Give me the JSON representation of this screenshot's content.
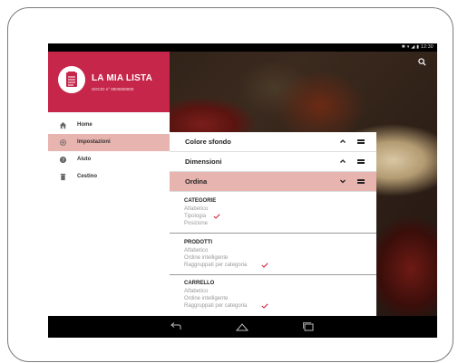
{
  "status_bar": {
    "time": "12:30"
  },
  "drawer": {
    "title": "LA MIA LISTA",
    "subtitle": "SOCIO n° 0000000000",
    "items": [
      {
        "label": "Home",
        "icon": "home-icon",
        "active": false
      },
      {
        "label": "Impostazioni",
        "icon": "gear-icon",
        "active": true
      },
      {
        "label": "Aiuto",
        "icon": "help-icon",
        "active": false
      },
      {
        "label": "Cestino",
        "icon": "trash-icon",
        "active": false
      }
    ]
  },
  "panel": {
    "accordions": [
      {
        "label": "Colore sfondo",
        "state": "collapsed"
      },
      {
        "label": "Dimensioni",
        "state": "collapsed"
      },
      {
        "label": "Ordina",
        "state": "expanded"
      }
    ],
    "sections": [
      {
        "title": "CATEGORIE",
        "options": [
          "Alfabetico",
          "Tipologia",
          "Posizione"
        ],
        "selected": 1
      },
      {
        "title": "PRODOTTI",
        "options": [
          "Alfabetico",
          "Ordine intelligente",
          "Raggruppati per categoria"
        ],
        "selected": 2
      },
      {
        "title": "CARRELLO",
        "options": [
          "Alfabetico",
          "Ordine intelligente",
          "Raggruppati per categoria"
        ],
        "selected": 2
      }
    ]
  },
  "colors": {
    "accent": "#c5264a",
    "selected_bg": "#e8b4b0",
    "check": "#d0283f"
  }
}
